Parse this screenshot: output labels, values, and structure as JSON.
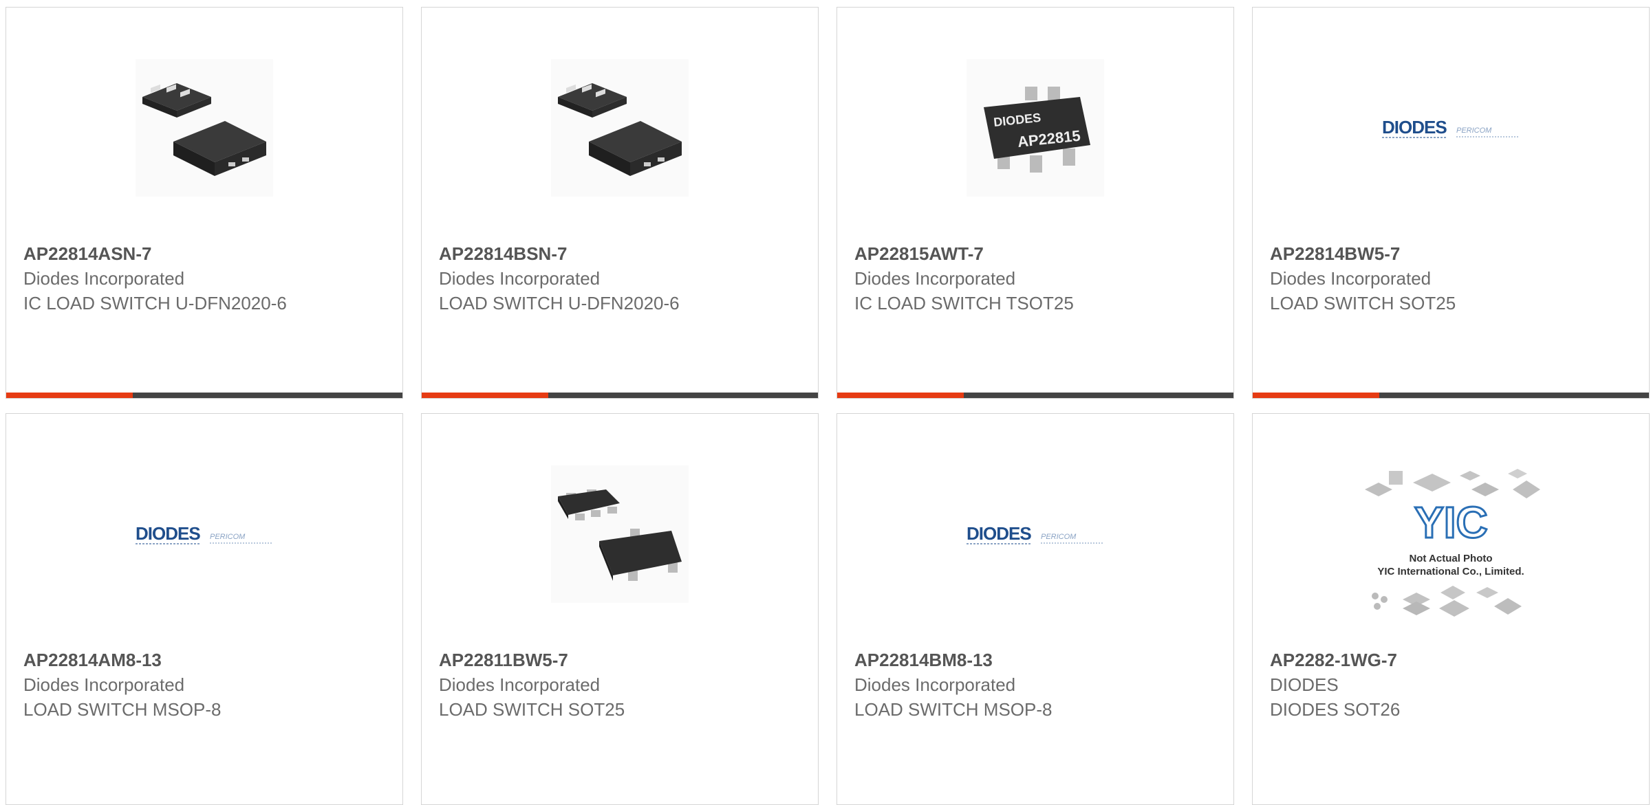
{
  "accent_color": "#e63b13",
  "bar_color": "#444444",
  "products": [
    {
      "part_number": "AP22814ASN-7",
      "manufacturer": "Diodes Incorporated",
      "description": "IC LOAD SWITCH U-DFN2020-6",
      "image": "dfn-package"
    },
    {
      "part_number": "AP22814BSN-7",
      "manufacturer": "Diodes Incorporated",
      "description": "LOAD SWITCH U-DFN2020-6",
      "image": "dfn-package"
    },
    {
      "part_number": "AP22815AWT-7",
      "manufacturer": "Diodes Incorporated",
      "description": "IC LOAD SWITCH TSOT25",
      "image": "tsot25-package",
      "chip_brand": "DIODES",
      "chip_marking": "AP22815"
    },
    {
      "part_number": "AP22814BW5-7",
      "manufacturer": "Diodes Incorporated",
      "description": "LOAD SWITCH SOT25",
      "image": "diodes-pericom-logo",
      "logo_main": "DIODES",
      "logo_sub": "PERICOM"
    },
    {
      "part_number": "AP22814AM8-13",
      "manufacturer": "Diodes Incorporated",
      "description": "LOAD SWITCH MSOP-8",
      "image": "diodes-pericom-logo",
      "logo_main": "DIODES",
      "logo_sub": "PERICOM"
    },
    {
      "part_number": "AP22811BW5-7",
      "manufacturer": "Diodes Incorporated",
      "description": "LOAD SWITCH SOT25",
      "image": "sot25-package"
    },
    {
      "part_number": "AP22814BM8-13",
      "manufacturer": "Diodes Incorporated",
      "description": "LOAD SWITCH MSOP-8",
      "image": "diodes-pericom-logo",
      "logo_main": "DIODES",
      "logo_sub": "PERICOM"
    },
    {
      "part_number": "AP2282-1WG-7",
      "manufacturer": "DIODES",
      "description": "DIODES SOT26",
      "image": "yic-placeholder",
      "placeholder_logo": "YIC",
      "placeholder_line1": "Not Actual Photo",
      "placeholder_line2": "YIC International Co., Limited."
    }
  ]
}
